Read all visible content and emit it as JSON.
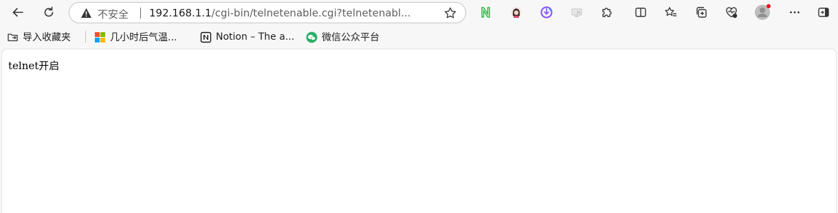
{
  "browser": {
    "address_bar": {
      "security_label": "不安全",
      "url_host": "192.168.1.1",
      "url_path": "/cgi-bin/telnetenable.cgi?telnetenabl..."
    },
    "toolbar_icons": [
      "back-icon",
      "refresh-icon",
      "warning-icon",
      "favorite-star-icon",
      "notion-n-extension-icon",
      "avatar-extension-icon",
      "download-extension-icon",
      "screen-extension-icon",
      "extensions-puzzle-icon",
      "split-screen-icon",
      "favorites-icon",
      "collections-icon",
      "browser-essentials-icon",
      "profile-icon",
      "more-icon",
      "sidebar-icon"
    ]
  },
  "bookmarks": [
    {
      "label": "导入收藏夹",
      "icon": "import-favorites-icon"
    },
    {
      "label": "几小时后气温...",
      "icon": "microsoft-logo-icon"
    },
    {
      "label": "Notion – The a...",
      "icon": "notion-icon"
    },
    {
      "label": "微信公众平台",
      "icon": "wechat-icon"
    }
  ],
  "page": {
    "body_text": "telnet开启"
  },
  "colors": {
    "profile_dot": "#e81123",
    "wechat": "#2aae67",
    "notion_ext": "#2fb84a"
  }
}
